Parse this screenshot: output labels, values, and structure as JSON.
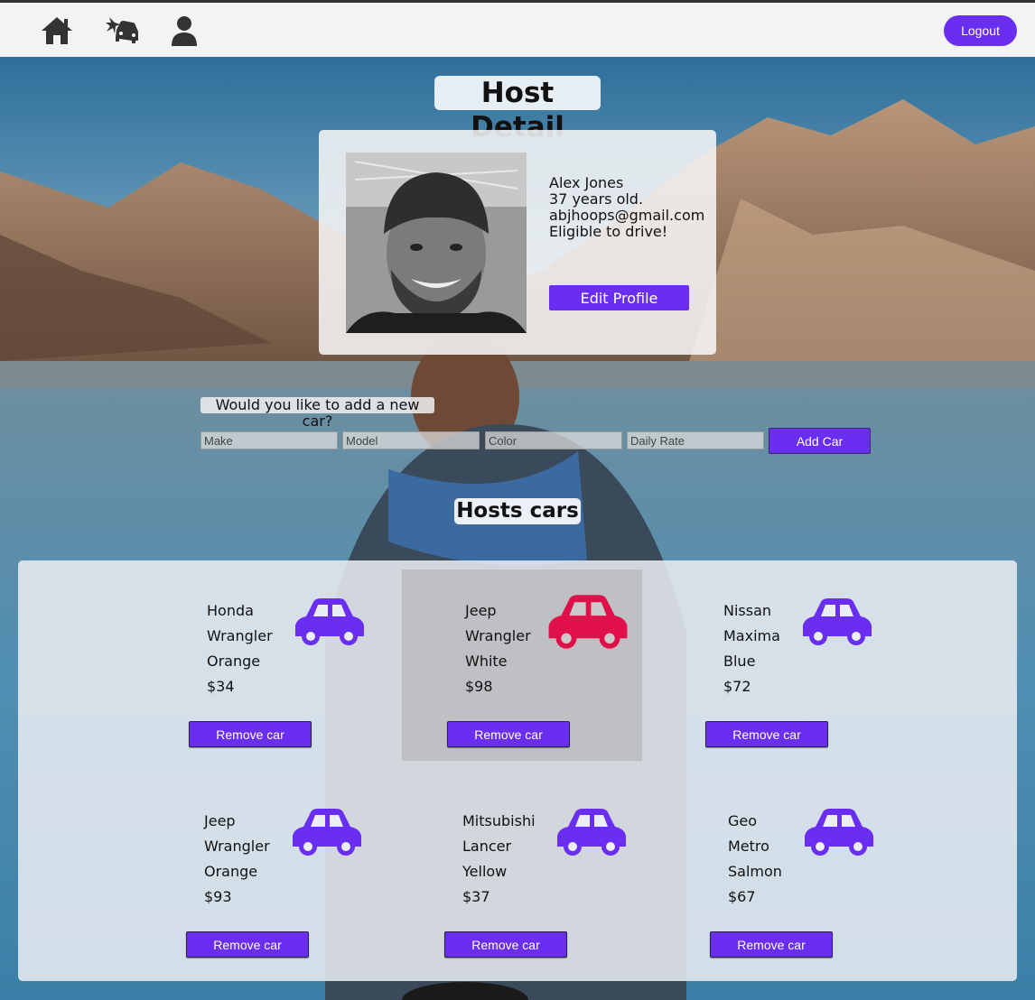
{
  "nav": {
    "icons": [
      "home-icon",
      "car-crash-icon",
      "user-icon"
    ],
    "logout_label": "Logout"
  },
  "page": {
    "title": "Host Detail"
  },
  "host": {
    "name": "Alex Jones",
    "age": "37 years old.",
    "email": "abjhoops@gmail.com",
    "status": "Eligible to drive!",
    "edit_label": "Edit Profile"
  },
  "add_car": {
    "prompt": "Would you like to add a new car?",
    "make_placeholder": "Make",
    "model_placeholder": "Model",
    "color_placeholder": "Color",
    "rate_placeholder": "Daily Rate",
    "button_label": "Add Car"
  },
  "cars_section": {
    "title": "Hosts cars",
    "remove_label": "Remove car"
  },
  "cars": [
    {
      "make": "Honda",
      "model": "Wrangler",
      "color": "Orange",
      "rate": "$34",
      "icon": "car-icon"
    },
    {
      "make": "Jeep",
      "model": "Wrangler",
      "color": "White",
      "rate": "$98",
      "icon": "car-icon"
    },
    {
      "make": "Nissan",
      "model": "Maxima",
      "color": "Blue",
      "rate": "$72",
      "icon": "car-icon"
    },
    {
      "make": "Jeep",
      "model": "Wrangler",
      "color": "Orange",
      "rate": "$93",
      "icon": "car-icon"
    },
    {
      "make": "Mitsubishi",
      "model": "Lancer",
      "color": "Yellow",
      "rate": "$37",
      "icon": "car-icon"
    },
    {
      "make": "Geo",
      "model": "Metro",
      "color": "Salmon",
      "rate": "$67",
      "icon": "car-icon"
    }
  ],
  "colors": {
    "accent": "#6a2ef0",
    "car_icon": "#6a2ef0",
    "car_icon_hover": "#e0104a"
  }
}
